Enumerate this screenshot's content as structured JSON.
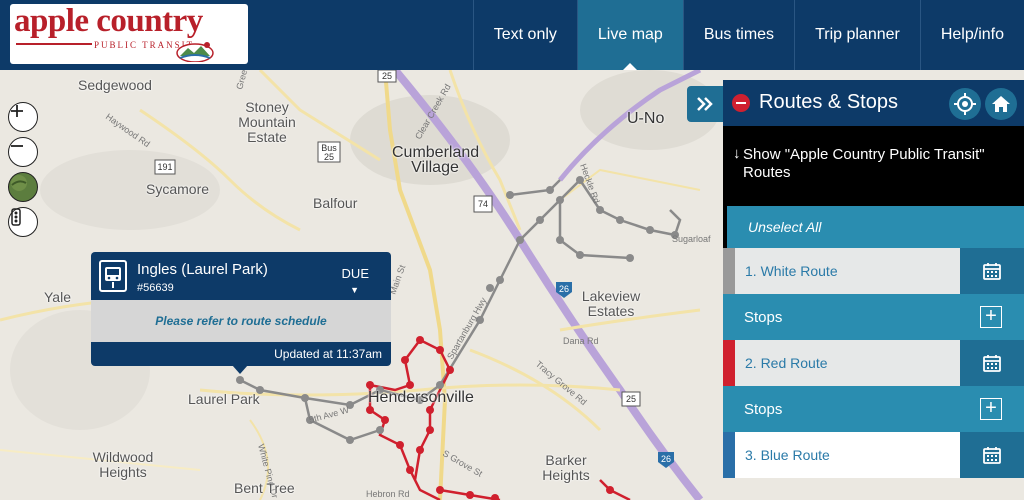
{
  "header": {
    "logo": {
      "line1": "apple country",
      "line2": "PUBLIC TRANSIT"
    },
    "nav": [
      {
        "label": "Text only"
      },
      {
        "label": "Live map"
      },
      {
        "label": "Bus times"
      },
      {
        "label": "Trip planner"
      },
      {
        "label": "Help/info"
      }
    ],
    "active_nav": "Live map"
  },
  "map": {
    "places": [
      "Sedgewood",
      "Stoney Mountain Estate",
      "Cumberland Village",
      "U-No",
      "Sycamore",
      "Balfour",
      "Yale",
      "Lakeview Estates",
      "Laurel Park",
      "Hendersonville",
      "Wildwood Heights",
      "Barker Heights",
      "Bent Tree"
    ],
    "road_labels": [
      "Haywood Rd",
      "Clear Creek Rd",
      "Main St",
      "Dana Rd",
      "Tracy Grove Rd",
      "Sugarloaf",
      "5th Ave W",
      "S Grove St",
      "Hebron Rd",
      "White Pine Dr",
      "Heckle Rd",
      "Spartanburg Hwy",
      "Greenville Hwy"
    ],
    "route_shields": [
      "191",
      "25",
      "Bus 25",
      "74",
      "26",
      "25",
      "26",
      "26"
    ],
    "controls": [
      "zoom-in",
      "zoom-out",
      "satellite",
      "layers"
    ]
  },
  "popup": {
    "stop_name": "Ingles (Laurel Park)",
    "stop_id": "#56639",
    "status": "DUE",
    "message": "Please refer to route schedule",
    "updated": "Updated at 11:37am"
  },
  "panel": {
    "title": "Routes & Stops",
    "show_routes": "Show \"Apple Country Public Transit\" Routes",
    "unselect_all": "Unselect All",
    "routes": [
      {
        "label": "1. White Route",
        "color": "#999999"
      },
      {
        "label": "2. Red Route",
        "color": "#d0202e"
      },
      {
        "label": "3. Blue Route",
        "color": "#2a6fa8"
      }
    ],
    "stops_label": "Stops"
  },
  "colors": {
    "header_bg": "#0d3a68",
    "accent": "#1f6e94",
    "stops_bg": "#2a8db0",
    "red_route": "#d0202e",
    "white_route": "#999999"
  }
}
